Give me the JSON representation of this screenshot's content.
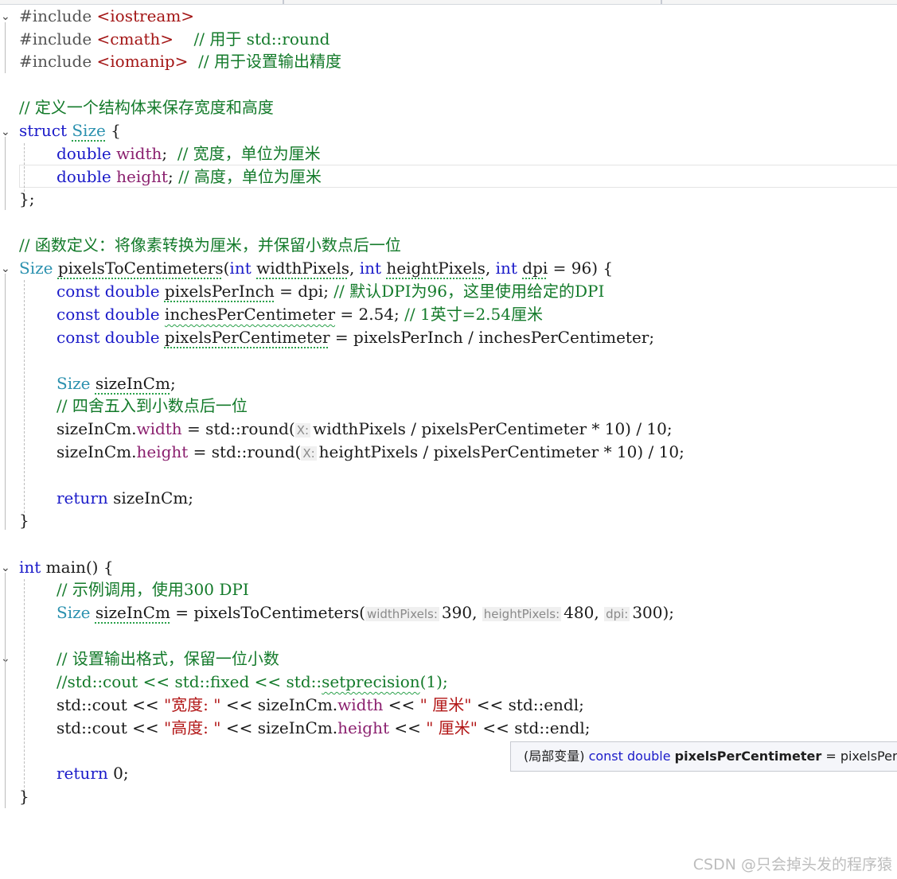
{
  "topbar": {},
  "fold_marker": "⌄",
  "code": {
    "l1": {
      "pp": "#include ",
      "inc": "<iostream>"
    },
    "l2": {
      "pp": "#include ",
      "inc": "<cmath>",
      "gap": "    ",
      "cm": "// 用于 std::round"
    },
    "l3": {
      "pp": "#include ",
      "inc": "<iomanip>",
      "gap": "  ",
      "cm": "// 用于设置输出精度"
    },
    "l5": {
      "cm": "// 定义一个结构体来保存宽度和高度"
    },
    "l6": {
      "kw": "struct",
      "ty": "Size",
      "rest": " {"
    },
    "l7": {
      "kw": "double",
      "fld": "width",
      "rest": ";  ",
      "cm": "// 宽度，单位为厘米"
    },
    "l8": {
      "kw": "double",
      "fld": "height",
      "rest": "; ",
      "cm": "// 高度，单位为厘米"
    },
    "l9": {
      "text": "};"
    },
    "l11": {
      "cm": "// 函数定义：将像素转换为厘米，并保留小数点后一位"
    },
    "l12": {
      "ty": "Size",
      "fn": "pixelsToCentimeters",
      "p1": "(",
      "kw1": "int",
      "a1": "widthPixels",
      "c1": ", ",
      "kw2": "int",
      "a2": "heightPixels",
      "c2": ", ",
      "kw3": "int",
      "a3": "dpi",
      "rest": " = 96) {"
    },
    "l13": {
      "kw1": "const",
      "kw2": "double",
      "v": "pixelsPerInch",
      "rest": " = dpi; ",
      "cm": "// 默认DPI为96，这里使用给定的DPI"
    },
    "l14": {
      "kw1": "const",
      "kw2": "double",
      "v": "inchesPerCentimeter",
      "rest": " = 2.54; ",
      "cm": "// 1英寸=2.54厘米"
    },
    "l15": {
      "kw1": "const",
      "kw2": "double",
      "v": "pixelsPerCentimeter",
      "rest": " = pixelsPerInch / inchesPerCentimeter;"
    },
    "l17": {
      "ty": "Size",
      "v": "sizeInCm",
      "rest": ";"
    },
    "l18": {
      "cm": "// 四舍五入到小数点后一位"
    },
    "l19": {
      "a": "sizeInCm.",
      "fld": "width",
      "b": " = std::round(",
      "hint": "X:",
      "c": "widthPixels / pixelsPerCentimeter * 10) / 10;"
    },
    "l20": {
      "a": "sizeInCm.",
      "fld": "height",
      "b": " = std::round(",
      "hint": "X:",
      "c": "heightPixels / pixelsPerCentimeter * 10) / 10;"
    },
    "l22": {
      "kw": "return",
      "rest": " sizeInCm;"
    },
    "l23": {
      "text": "}"
    },
    "l25": {
      "kw": "int",
      "rest": " main() {"
    },
    "l26": {
      "cm": "// 示例调用，使用300 DPI"
    },
    "l27": {
      "ty": "Size",
      "v": "sizeInCm",
      "b": " = pixelsToCentimeters(",
      "h1": "widthPixels:",
      "n1": "390, ",
      "h2": "heightPixels:",
      "n2": "480, ",
      "h3": "dpi:",
      "n3": "300);"
    },
    "l29": {
      "cm": "// 设置输出格式，保留一位小数"
    },
    "l30": {
      "cm1": "//std::cout << std::fixed << std::",
      "cm2": "setprecision",
      "cm3": "(1);"
    },
    "l31": {
      "a": "std::cout << ",
      "s1": "\"宽度: \"",
      "b": " << sizeInCm.",
      "fld": "width",
      "c": " << ",
      "s2": "\" 厘米\"",
      "d": " << std::endl;"
    },
    "l32": {
      "a": "std::cout << ",
      "s1": "\"高度: \"",
      "b": " << sizeInCm.",
      "fld": "height",
      "c": " << ",
      "s2": "\" 厘米\"",
      "d": " << std::endl;"
    },
    "l34": {
      "kw": "return",
      "rest": " 0;"
    },
    "l35": {
      "text": "}"
    }
  },
  "tooltip": {
    "prefix": "(局部变量) ",
    "kw": "const double ",
    "name": "pixelsPerCentimeter",
    "rest": " = pixelsPerInc"
  },
  "watermark": "CSDN @只会掉头发的程序猿"
}
